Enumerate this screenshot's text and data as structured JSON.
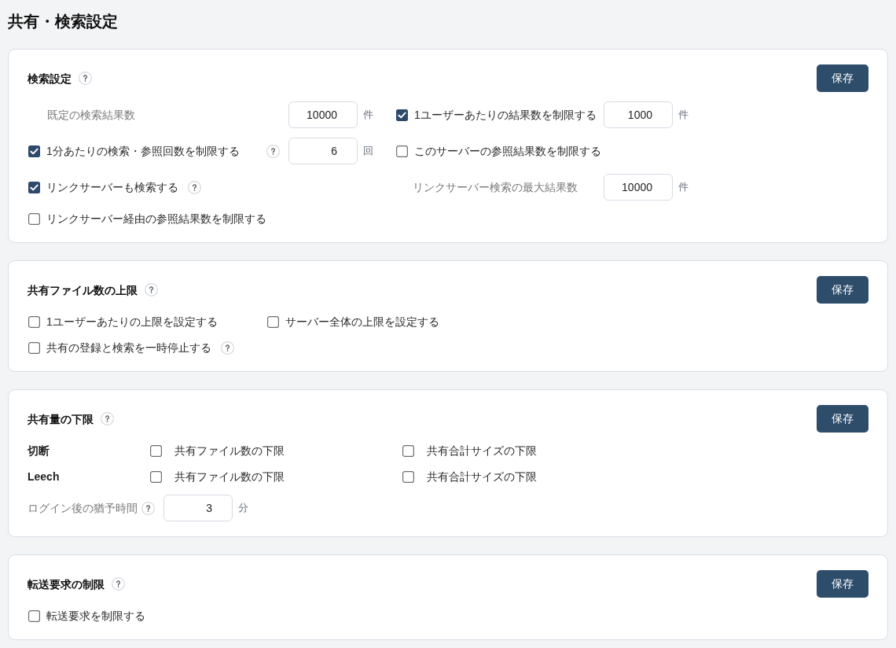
{
  "page": {
    "title": "共有・検索設定"
  },
  "sections": [
    {
      "kind": "search",
      "title": "検索設定",
      "help": true,
      "save_button": "保存",
      "rows": [
        {
          "items": [
            {
              "kind": "number",
              "label": "既定の検索結果数",
              "value": "10000",
              "unit": "件"
            },
            {
              "kind": "check_number",
              "label": "1ユーザーあたりの結果数を制限する",
              "checked": true,
              "value": "1000",
              "unit": "件"
            }
          ]
        },
        {
          "items": [
            {
              "kind": "check_number",
              "label": "1分あたりの検索・参照回数を制限する",
              "checked": true,
              "help": true,
              "value": "6",
              "unit": "回"
            },
            {
              "kind": "check",
              "label": "このサーバーの参照結果数を制限する",
              "checked": false
            }
          ]
        },
        {
          "items": [
            {
              "kind": "check",
              "label": "リンクサーバーも検索する",
              "checked": true,
              "help": true
            },
            {
              "kind": "number",
              "label": "リンクサーバー検索の最大結果数",
              "value": "10000",
              "unit": "件"
            }
          ]
        },
        {
          "items": [
            {
              "kind": "check",
              "label": "リンクサーバー経由の参照結果数を制限する",
              "checked": false
            }
          ]
        }
      ]
    },
    {
      "kind": "checks",
      "title": "共有ファイル数の上限",
      "help": true,
      "save_button": "保存",
      "rows": [
        {
          "items": [
            {
              "kind": "check",
              "label": "1ユーザーあたりの上限を設定する",
              "checked": false
            },
            {
              "kind": "check",
              "label": "サーバー全体の上限を設定する",
              "checked": false
            }
          ]
        },
        {
          "items": [
            {
              "kind": "check",
              "label": "共有の登録と検索を一時停止する",
              "checked": false,
              "help": true
            }
          ]
        }
      ]
    },
    {
      "kind": "minimums",
      "title": "共有量の下限",
      "help": true,
      "save_button": "保存",
      "rows": [
        {
          "label": "切断",
          "items": [
            {
              "label": "共有ファイル数の下限",
              "checked": false
            },
            {
              "label": "共有合計サイズの下限",
              "checked": false
            }
          ]
        },
        {
          "label": "Leech",
          "items": [
            {
              "label": "共有ファイル数の下限",
              "checked": false
            },
            {
              "label": "共有合計サイズの下限",
              "checked": false
            }
          ]
        }
      ],
      "grace": {
        "label": "ログイン後の猶予時間",
        "help": true,
        "value": "3",
        "unit": "分"
      }
    },
    {
      "kind": "checks",
      "title": "転送要求の制限",
      "help": true,
      "save_button": "保存",
      "rows": [
        {
          "items": [
            {
              "kind": "check",
              "label": "転送要求を制限する",
              "checked": false
            }
          ]
        }
      ]
    }
  ]
}
